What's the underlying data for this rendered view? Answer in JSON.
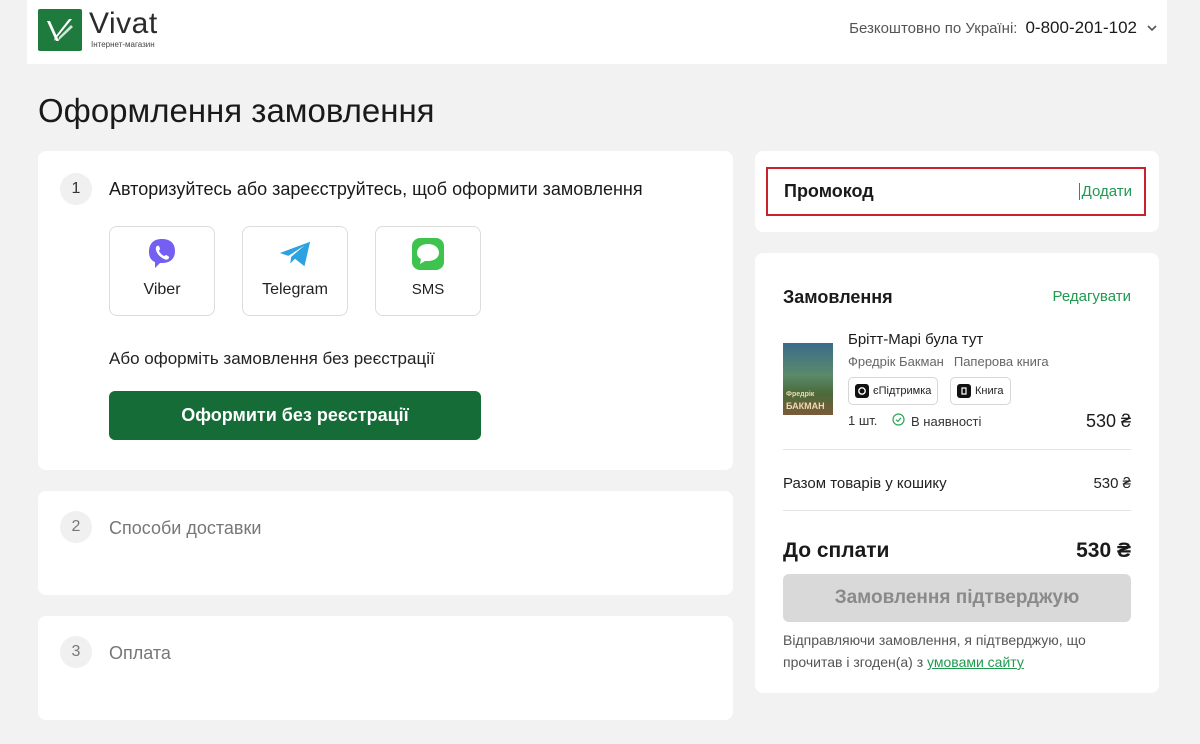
{
  "header": {
    "logo_word": "Vivat",
    "logo_sub": "Інтернет-магазин",
    "phone_label": "Безкоштовно по Україні:",
    "phone_number": "0-800-201-102"
  },
  "page_title": "Оформлення замовлення",
  "steps": [
    {
      "number": "1",
      "title": "Авторизуйтесь або зареєструйтесь, щоб оформити замовлення"
    },
    {
      "number": "2",
      "title": "Способи доставки"
    },
    {
      "number": "3",
      "title": "Оплата"
    }
  ],
  "auth_options": [
    {
      "label": "Viber",
      "icon": "viber-icon",
      "color": "#7360f2"
    },
    {
      "label": "Telegram",
      "icon": "telegram-icon",
      "color": "#2aa3e0"
    },
    {
      "label": "SMS",
      "icon": "sms-icon",
      "color": "#3fc34f"
    }
  ],
  "guest": {
    "text": "Або оформіть замовлення без реєстрації",
    "button": "Оформити без реєстрації"
  },
  "promo": {
    "label": "Промокод",
    "add": "Додати"
  },
  "order": {
    "title": "Замовлення",
    "edit": "Редагувати",
    "item": {
      "cover_line1": "Фредрік",
      "cover_line2": "БАКМАН",
      "title": "Брітт-Марі була тут",
      "author": "Фредрік Бакман",
      "format": "Паперова книга",
      "tags": [
        "єПідтримка",
        "Книга"
      ],
      "qty": "1 шт.",
      "stock": "В наявності",
      "price": "530 ₴"
    },
    "subtotal_label": "Разом товарів у кошику",
    "subtotal_value": "530 ₴",
    "total_label": "До сплати",
    "total_value": "530 ₴",
    "confirm_button": "Замовлення підтверджую",
    "terms_text": "Відправляючи замовлення, я підтверджую, що прочитав і згоден(а) з",
    "terms_link": "умовами сайту"
  },
  "colors": {
    "brand_green": "#156c37",
    "link_green": "#1f9a50",
    "promo_highlight": "#c8232c"
  }
}
